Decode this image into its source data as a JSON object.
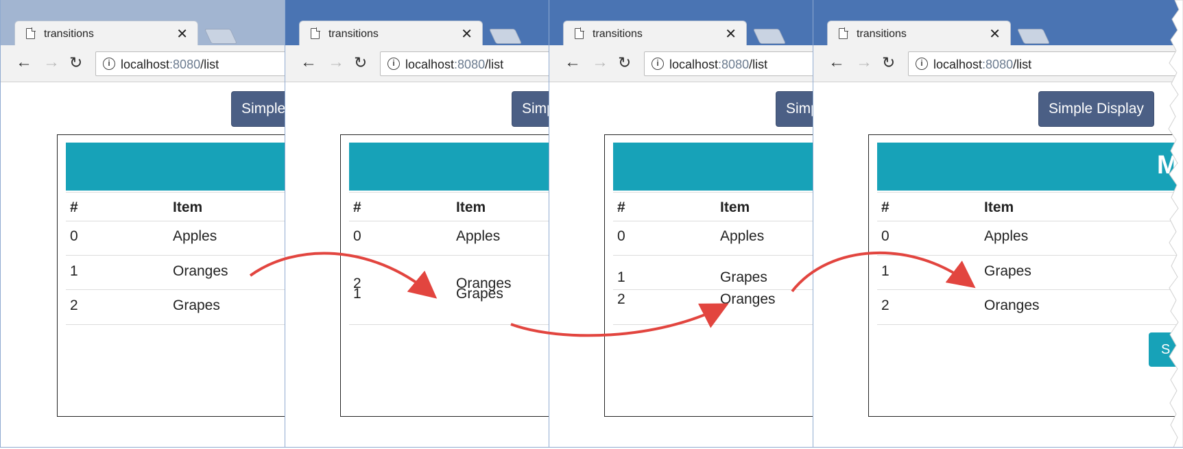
{
  "tab": {
    "title": "transitions",
    "close": "✕"
  },
  "toolbar": {
    "back": "←",
    "forward": "→",
    "reload": "↻",
    "info": "i"
  },
  "address": {
    "host": "localhost",
    "port": ":8080",
    "path": "/list"
  },
  "button": {
    "label": "Simple Display"
  },
  "panel": {
    "heading_partial": "M",
    "side_button_partial": "S"
  },
  "table": {
    "headers": {
      "num": "#",
      "item": "Item"
    }
  },
  "frames": [
    {
      "rows": [
        {
          "num": "0",
          "item": "Apples"
        },
        {
          "num": "1",
          "item": "Oranges"
        },
        {
          "num": "2",
          "item": "Grapes"
        }
      ]
    },
    {
      "rows": [
        {
          "num": "0",
          "item": "Apples"
        },
        {
          "num": "2",
          "item": "Oranges"
        },
        {
          "num": "1",
          "item": "Grapes"
        }
      ]
    },
    {
      "rows": [
        {
          "num": "0",
          "item": "Apples"
        },
        {
          "num": "1",
          "item": "Grapes"
        },
        {
          "num": "2",
          "item": "Oranges"
        }
      ]
    },
    {
      "rows": [
        {
          "num": "0",
          "item": "Apples"
        },
        {
          "num": "1",
          "item": "Grapes"
        },
        {
          "num": "2",
          "item": "Oranges"
        }
      ]
    }
  ],
  "colors": {
    "accent": "#17a2b8",
    "button": "#4b5f85",
    "arrow": "#e2453f",
    "chrome": "#4a74b3"
  }
}
